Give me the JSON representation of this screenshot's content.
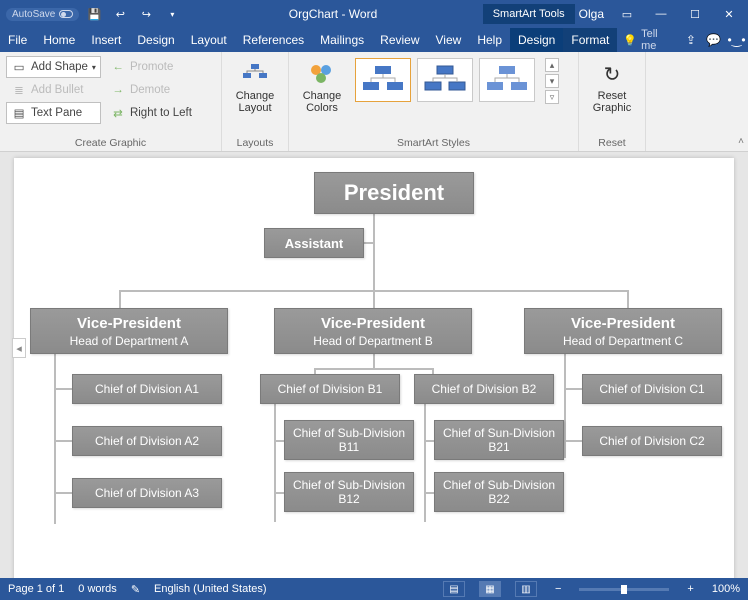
{
  "titlebar": {
    "autosave_label": "AutoSave",
    "doc_title": "OrgChart - Word",
    "tools_label": "SmartArt Tools",
    "user_name": "Olga"
  },
  "tabs": {
    "file": "File",
    "home": "Home",
    "insert": "Insert",
    "design": "Design",
    "layout": "Layout",
    "references": "References",
    "mailings": "Mailings",
    "review": "Review",
    "view": "View",
    "help": "Help",
    "sa_design": "Design",
    "sa_format": "Format",
    "tell_me": "Tell me"
  },
  "ribbon": {
    "create": {
      "add_shape": "Add Shape",
      "add_bullet": "Add Bullet",
      "text_pane": "Text Pane",
      "promote": "Promote",
      "demote": "Demote",
      "rtl": "Right to Left",
      "group_label": "Create Graphic"
    },
    "layouts": {
      "change_layout": "Change\nLayout",
      "group_label": "Layouts"
    },
    "colors": {
      "change_colors": "Change\nColors"
    },
    "styles_label": "SmartArt Styles",
    "reset": {
      "reset_graphic": "Reset\nGraphic",
      "group_label": "Reset"
    }
  },
  "chart_data": {
    "type": "org-chart",
    "root": {
      "title": "President"
    },
    "assistant": {
      "title": "Assistant"
    },
    "branches": [
      {
        "title": "Vice-President",
        "subtitle": "Head of Department A",
        "children": [
          {
            "title": "Chief of Division A1"
          },
          {
            "title": "Chief of Division A2"
          },
          {
            "title": "Chief of Division A3"
          }
        ]
      },
      {
        "title": "Vice-President",
        "subtitle": "Head of Department B",
        "children": [
          {
            "title": "Chief of Division B1",
            "children": [
              {
                "title": "Chief of Sub-Division B11"
              },
              {
                "title": "Chief of Sub-Division B12"
              }
            ]
          },
          {
            "title": "Chief of Division B2",
            "children": [
              {
                "title": "Chief of Sun-Division B21"
              },
              {
                "title": "Chief of Sub-Division B22"
              }
            ]
          }
        ]
      },
      {
        "title": "Vice-President",
        "subtitle": "Head of Department C",
        "children": [
          {
            "title": "Chief of Division C1"
          },
          {
            "title": "Chief of Division C2"
          }
        ]
      }
    ]
  },
  "status": {
    "page": "Page 1 of 1",
    "words": "0 words",
    "lang": "English (United States)",
    "zoom": "100%"
  }
}
